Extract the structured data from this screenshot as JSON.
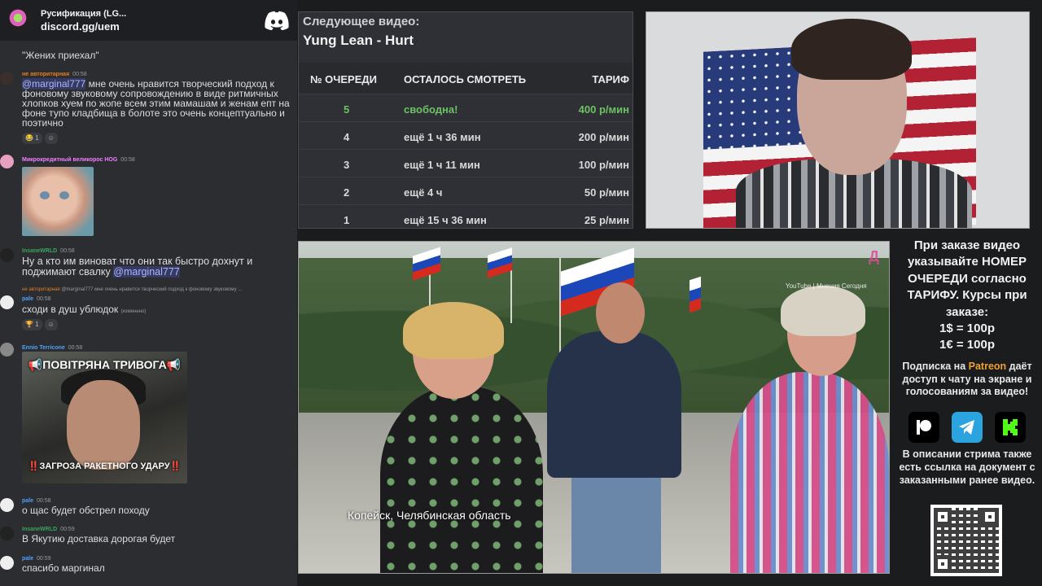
{
  "chat": {
    "server_name": "Русификация (LG...",
    "server_link": "discord.gg/uem",
    "truncated_top_line": "\"Жених приехал\"",
    "messages": [
      {
        "user": "не авторитарная",
        "time": "00:58",
        "user_color": "#e67e22",
        "text_pre": "",
        "mention": "@marginal777",
        "text": " мне очень нравится творческий подход к фоновому звуковому сопровождению в виде ритмичных хлопков хуем по жопе всем этим мамашам и женам епт на фоне тупо кладбища в болоте это очень концептуально и поэтично",
        "reaction": "1"
      },
      {
        "user": "Микрокредитный великорос",
        "badge": "HOG",
        "time": "00:58",
        "user_color": "#f47fff"
      },
      {
        "user": "InsaneWRLD",
        "time": "00:58",
        "user_color": "#3ba55d",
        "text": "Ну а кто им виноват что они так быстро дохнут и поджимают свалку ",
        "mention": "@marginal777"
      },
      {
        "reply_user": "не авторитарная",
        "reply_text": "@marginal777 мне очень нравится творческий подход к фоновому звуковому ...",
        "user": "pale",
        "time": "00:58",
        "user_color": "#4fa3f7",
        "text": "сходи в душ ублюдок",
        "edited": "(изменено)",
        "reaction": "1"
      },
      {
        "user": "Ennio Terricone",
        "time": "00:58",
        "user_color": "#4fa3f7"
      },
      {
        "user": "pale",
        "time": "00:58",
        "user_color": "#4fa3f7",
        "text": "о щас будет обстрел походу"
      },
      {
        "user": "InsaneWRLD",
        "time": "00:59",
        "user_color": "#3ba55d",
        "text": "В Якутию доставка дорогая будет"
      },
      {
        "user": "pale",
        "time": "00:59",
        "user_color": "#4fa3f7",
        "text": "спасибо маргинал"
      }
    ],
    "meme": {
      "top": "📢ПОВІТРЯНА ТРИВОГА📢",
      "bottom": "‼️ЗАГРОЗА РАКЕТНОГО УДАРУ‼️"
    }
  },
  "queue": {
    "next_label": "Следующее видео:",
    "next_title": "Yung Lean - Hurt",
    "headers": [
      "№ ОЧЕРЕДИ",
      "ОСТАЛОСЬ СМОТРЕТЬ",
      "ТАРИФ"
    ],
    "rows": [
      {
        "num": "5",
        "remaining": "свободна!",
        "rate": "400 р/мин"
      },
      {
        "num": "4",
        "remaining": "ещё 1 ч 36 мин",
        "rate": "200 р/мин"
      },
      {
        "num": "3",
        "remaining": "ещё 1 ч 11 мин",
        "rate": "100 р/мин"
      },
      {
        "num": "2",
        "remaining": "ещё 4 ч",
        "rate": "50 р/мин"
      },
      {
        "num": "1",
        "remaining": "ещё 15 ч 36 мин",
        "rate": "25 р/мин"
      }
    ],
    "free_color": "#6cc264"
  },
  "video": {
    "caption": "Копейск, Челябинская область",
    "watermark": "YouTube | Мнения Сегодня",
    "channel_logo": "Д"
  },
  "info": {
    "main": "При заказе видео указывайте НОМЕР ОЧЕРЕДИ согласно ТАРИФУ. Курсы при заказе:",
    "rate_usd": "1$ = 100р",
    "rate_eur": "1€ = 100р",
    "sub_pre": "Подписка на ",
    "patreon": "Patreon",
    "sub_post": " даёт доступ к чату на экране и голосованиям за видео!",
    "description": "В описании стрима также есть ссылка на документ с заказанными ранее видео.",
    "icons": [
      "patreon-icon",
      "telegram-icon",
      "kick-icon"
    ],
    "patreon_color": "#f0a030"
  }
}
